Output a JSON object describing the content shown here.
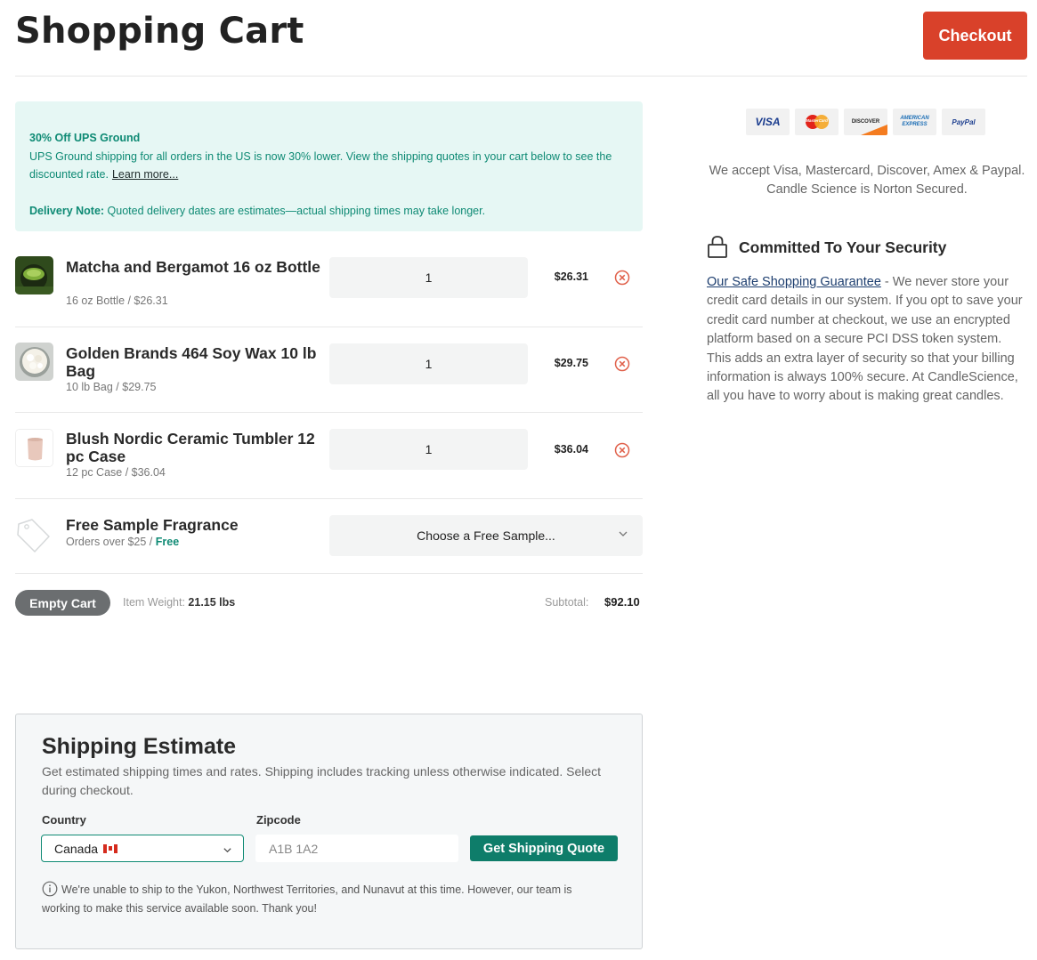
{
  "header": {
    "title": "Shopping Cart",
    "checkout_label": "Checkout"
  },
  "notice": {
    "title": "30% Off UPS Ground",
    "body": "UPS Ground shipping for all orders in the US is now 30% lower. View the shipping quotes in your cart below to see the discounted rate.",
    "link": "Learn more...",
    "delivery_label": "Delivery Note:",
    "delivery_text": "Quoted delivery dates are estimates—actual shipping times may take longer."
  },
  "cart": {
    "items": [
      {
        "name": "Matcha and Bergamot 16 oz Bottle",
        "sub": "16 oz Bottle / $26.31",
        "qty": "1",
        "price": "$26.31",
        "icon": "matcha-bottle-image"
      },
      {
        "name": "Golden Brands 464 Soy Wax 10 lb Bag",
        "sub": "10 lb Bag / $29.75",
        "qty": "1",
        "price": "$29.75",
        "icon": "soy-wax-image"
      },
      {
        "name": "Blush Nordic Ceramic Tumbler 12 pc Case",
        "sub": "12 pc Case / $36.04",
        "qty": "1",
        "price": "$36.04",
        "icon": "tumbler-image"
      }
    ],
    "sample": {
      "name": "Free Sample Fragrance",
      "sub_prefix": "Orders over $25 /",
      "sub_free": "Free",
      "select_label": "Choose a Free Sample..."
    },
    "empty_label": "Empty Cart",
    "weight_label": "Item Weight:",
    "weight_value": "21.15 lbs",
    "subtotal_label": "Subtotal:",
    "subtotal_value": "$92.10"
  },
  "shipping": {
    "title": "Shipping Estimate",
    "description": "Get estimated shipping times and rates. Shipping includes tracking unless otherwise indicated. Select during checkout.",
    "country_label": "Country",
    "country_value": "Canada",
    "zip_label": "Zipcode",
    "zip_placeholder": "A1B 1A2",
    "quote_label": "Get Shipping Quote",
    "note": "We're unable to ship to the Yukon, Northwest Territories, and Nunavut at this time. However, our team is working to make this service available soon. Thank you!"
  },
  "payment": {
    "cards": [
      "VISA",
      "MasterCard",
      "DISCOVER",
      "AMERICAN EXPRESS",
      "PayPal"
    ],
    "accept_text": "We accept Visa, Mastercard, Discover, Amex & Paypal. Candle Science is Norton Secured."
  },
  "security": {
    "title": "Committed To Your Security",
    "link": "Our Safe Shopping Guarantee",
    "text": " - We never store your credit card details in our system. If you opt to save your credit card number at checkout, we use an encrypted platform based on a secure PCI DSS token system. This adds an extra layer of security so that your billing information is always 100% secure. At CandleScience, all you have to worry about is making great candles."
  },
  "colors": {
    "accent": "#0e8a74",
    "checkout": "#d9412a",
    "notice_bg": "#e6f7f4",
    "remove": "#e0604a"
  }
}
